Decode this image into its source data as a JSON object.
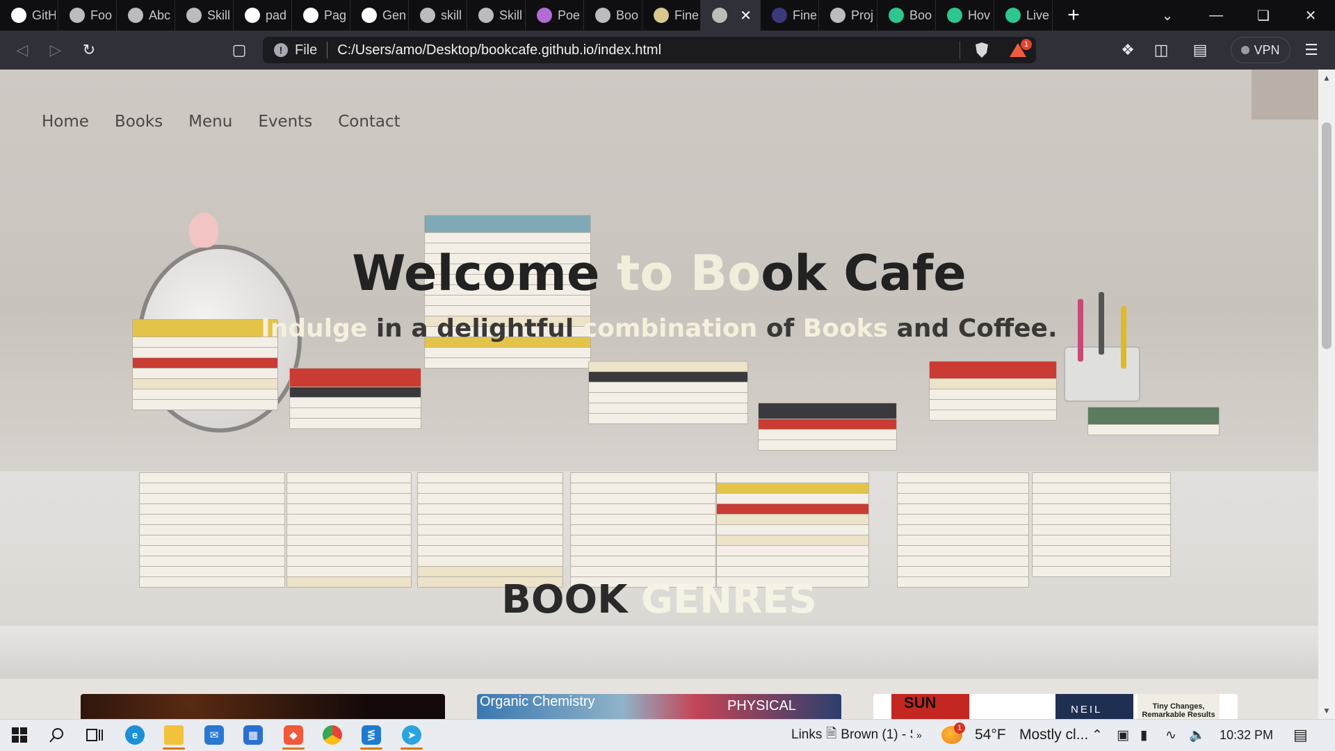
{
  "browser": {
    "tabs": [
      {
        "label": "GitH",
        "icon": "github-icon",
        "color": "#ffffff"
      },
      {
        "label": "Foo",
        "icon": "sketch-icon",
        "color": "#bcbcbc"
      },
      {
        "label": "Abc",
        "icon": "dots-icon",
        "color": "#bcbcbc"
      },
      {
        "label": "Skill",
        "icon": "globe-icon",
        "color": "#bcbcbc"
      },
      {
        "label": "pad",
        "icon": "google-icon",
        "color": "#ffffff"
      },
      {
        "label": "Pag",
        "icon": "github-icon",
        "color": "#ffffff"
      },
      {
        "label": "Gen",
        "icon": "github-icon",
        "color": "#ffffff"
      },
      {
        "label": "skill",
        "icon": "globe-icon",
        "color": "#bcbcbc"
      },
      {
        "label": "Skill",
        "icon": "globe-icon",
        "color": "#bcbcbc"
      },
      {
        "label": "Poe",
        "icon": "poe-icon",
        "color": "#b56bd6"
      },
      {
        "label": "Boo",
        "icon": "globe-icon",
        "color": "#bcbcbc"
      },
      {
        "label": "Fine",
        "icon": "image-icon",
        "color": "#d8c78f"
      },
      {
        "label": "",
        "icon": "globe-icon",
        "color": "#bcbcbc",
        "active": true
      },
      {
        "label": "Fine",
        "icon": "doc-icon",
        "color": "#3a3a7a"
      },
      {
        "label": "Proj",
        "icon": "globe-icon",
        "color": "#bcbcbc"
      },
      {
        "label": "Boo",
        "icon": "shield-icon",
        "color": "#2ec68f"
      },
      {
        "label": "Hov",
        "icon": "shield-icon",
        "color": "#2ec68f"
      },
      {
        "label": "Live",
        "icon": "shield-icon",
        "color": "#2ec68f"
      }
    ],
    "address": {
      "scheme_label": "File",
      "url": "C:/Users/amo/Desktop/bookcafe.github.io/index.html"
    },
    "rewards_badge": "1",
    "vpn_label": "VPN"
  },
  "page": {
    "nav": [
      "Home",
      "Books",
      "Menu",
      "Events",
      "Contact"
    ],
    "hero": {
      "title_parts": [
        "Welcome ",
        "to Bo",
        "ok Cafe"
      ],
      "subtitle_parts": [
        "Indulge",
        " in a delightful ",
        "combination",
        " of ",
        "Books",
        " and Coffee."
      ]
    },
    "genres": {
      "title_parts": [
        "BOOK ",
        "GENRES"
      ]
    },
    "cards": {
      "card2_text": "Organic Chemistry",
      "card2_text_b": "PHYSICAL",
      "card3_red": "SUN",
      "card3_navy": "NEIL",
      "card3_cream": "Tiny Changes, Remarkable Results"
    }
  },
  "taskbar": {
    "links_label": "Links",
    "doc_label": "Brown (1) - S",
    "weather_temp": "54°F",
    "weather_text": "Mostly cl...",
    "weather_badge": "1",
    "time": "10:32 PM"
  }
}
